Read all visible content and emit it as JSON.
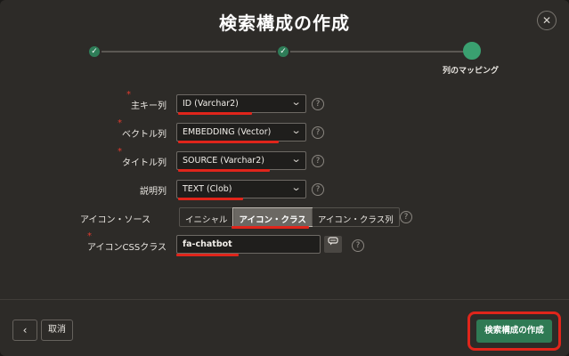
{
  "dialog": {
    "title": "検索構成の作成",
    "close_glyph": "✕"
  },
  "wizard": {
    "steps": [
      {
        "state": "complete",
        "glyph": "✓"
      },
      {
        "state": "complete",
        "glyph": "✓"
      },
      {
        "state": "current",
        "label": "列のマッピング"
      }
    ]
  },
  "form": {
    "primary_key": {
      "label": "主キー列",
      "required": true,
      "value": "ID (Varchar2)"
    },
    "vector": {
      "label": "ベクトル列",
      "required": true,
      "value": "EMBEDDING (Vector)"
    },
    "title_col": {
      "label": "タイトル列",
      "required": true,
      "value": "SOURCE (Varchar2)"
    },
    "description": {
      "label": "説明列",
      "required": false,
      "value": "TEXT (Clob)"
    },
    "icon_source": {
      "label": "アイコン・ソース",
      "options": [
        "イニシャル",
        "アイコン・クラス",
        "アイコン・クラス列"
      ],
      "selected": "アイコン・クラス"
    },
    "icon_css": {
      "label": "アイコンCSSクラス",
      "required": true,
      "value": "fa-chatbot"
    },
    "required_mark": "*",
    "help_glyph": "?",
    "select_chevron": "⌄"
  },
  "footer": {
    "back_glyph": "‹",
    "cancel_label": "取消",
    "create_label": "検索構成の作成"
  },
  "colors": {
    "accent_green": "#2f7a54",
    "highlight_red": "#e0251b",
    "background": "#2d2b28"
  }
}
